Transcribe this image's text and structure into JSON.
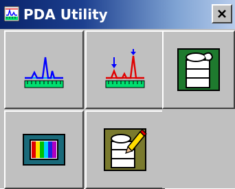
{
  "window": {
    "title": "PDA Utility",
    "app_icon": "pda-utility-app-icon",
    "close_icon": "close-icon",
    "close_glyph": "✕"
  },
  "toolbar": {
    "buttons": [
      {
        "icon": "chromatogram-spectrum-icon"
      },
      {
        "icon": "peak-marker-spectrum-icon"
      },
      {
        "icon": "green-stack-document-icon"
      },
      {
        "icon": "color-spectrum-bars-icon"
      },
      {
        "icon": "edit-document-pencil-icon"
      }
    ]
  },
  "colors": {
    "titlebar_dark": "#0a246a",
    "titlebar_light": "#b7ccec",
    "face": "#c0c0c0",
    "spectrum_blue": "#0000ff",
    "spectrum_red": "#e00000",
    "ruler_green": "#00e070",
    "doc_green": "#1e7a2e",
    "doc_olive": "#7a7a2e",
    "panel_teal": "#1a6a7a"
  }
}
